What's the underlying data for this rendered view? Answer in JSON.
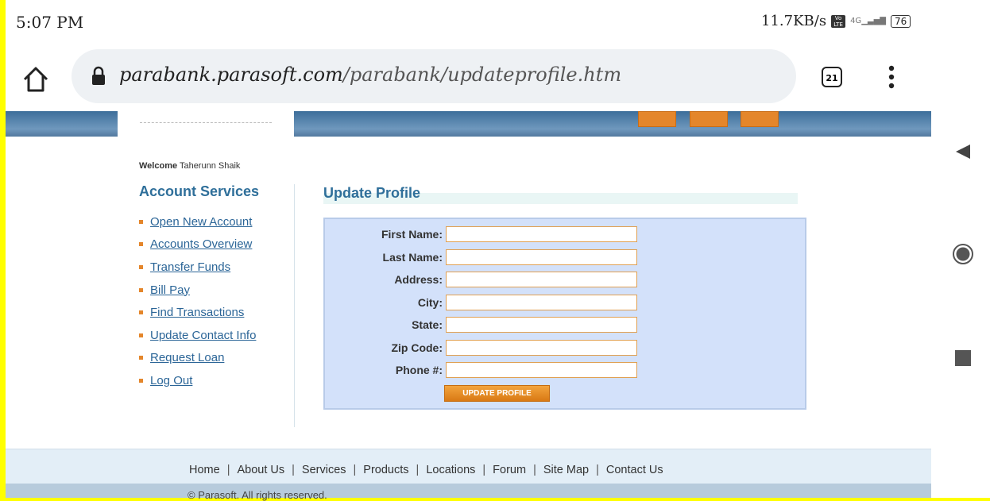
{
  "status_bar": {
    "time": "5:07 PM",
    "speed": "11.7KB/s",
    "volte": "Vo LTE",
    "network": "4G",
    "battery": "76"
  },
  "browser": {
    "url_domain": "parabank.parasoft.com",
    "url_path": "/parabank/updateprofile.htm",
    "tab_count": "21"
  },
  "sidebar": {
    "welcome_label": "Welcome",
    "user_name": "Taherunn Shaik",
    "title": "Account Services",
    "items": [
      {
        "label": "Open New Account"
      },
      {
        "label": "Accounts Overview"
      },
      {
        "label": "Transfer Funds"
      },
      {
        "label": "Bill Pay"
      },
      {
        "label": "Find Transactions"
      },
      {
        "label": "Update Contact Info"
      },
      {
        "label": "Request Loan"
      },
      {
        "label": "Log Out"
      }
    ]
  },
  "main": {
    "title": "Update Profile",
    "fields": [
      {
        "label": "First Name:",
        "value": ""
      },
      {
        "label": "Last Name:",
        "value": ""
      },
      {
        "label": "Address:",
        "value": ""
      },
      {
        "label": "City:",
        "value": ""
      },
      {
        "label": "State:",
        "value": ""
      },
      {
        "label": "Zip Code:",
        "value": ""
      },
      {
        "label": "Phone #:",
        "value": ""
      }
    ],
    "submit_label": "UPDATE PROFILE"
  },
  "footer": {
    "links": [
      "Home",
      "About Us",
      "Services",
      "Products",
      "Locations",
      "Forum",
      "Site Map",
      "Contact Us"
    ],
    "copyright": "© Parasoft. All rights reserved."
  },
  "colors": {
    "accent": "#2f6f9a",
    "button": "#e4862b",
    "form_bg": "#d3e1fa",
    "frame": "#ffff00"
  }
}
